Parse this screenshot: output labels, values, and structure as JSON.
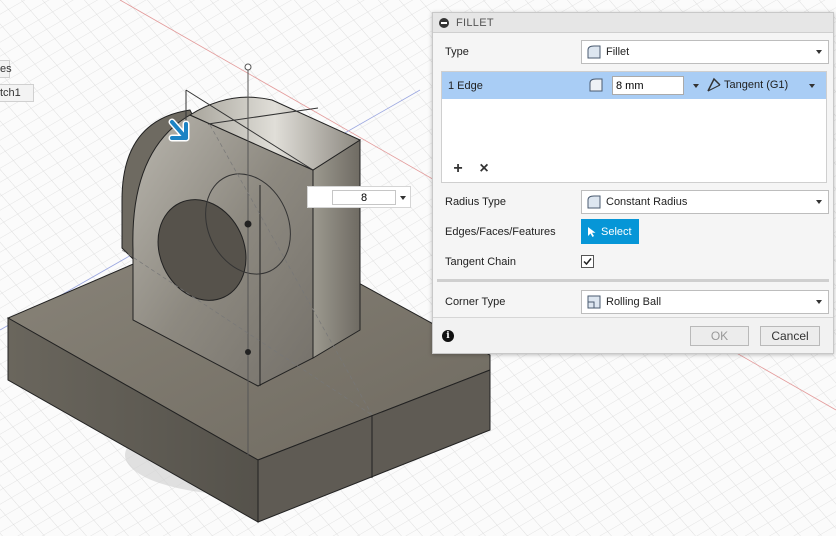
{
  "browser": {
    "item_1": "es",
    "item_2": "tch1"
  },
  "manipulator": {
    "value": "8"
  },
  "dialog": {
    "title": "FILLET",
    "type": {
      "label": "Type",
      "value": "Fillet"
    },
    "edge_row": {
      "name": "1 Edge",
      "radius": "8 mm",
      "continuity": "Tangent (G1)"
    },
    "tools": {
      "add": "+",
      "remove": "×"
    },
    "radius_type": {
      "label": "Radius Type",
      "value": "Constant Radius"
    },
    "edges": {
      "label": "Edges/Faces/Features",
      "button": "Select"
    },
    "tangent_chain": {
      "label": "Tangent Chain",
      "checked": true
    },
    "corner_type": {
      "label": "Corner Type",
      "value": "Rolling Ball"
    },
    "ok": "OK",
    "cancel": "Cancel",
    "info": "i"
  },
  "colors": {
    "accent": "#0696d7",
    "selection": "#a9cdf5",
    "body": "#6e6a61"
  }
}
